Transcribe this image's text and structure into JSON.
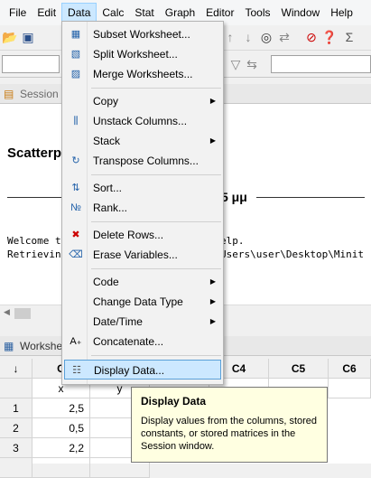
{
  "menubar": [
    "File",
    "Edit",
    "Data",
    "Calc",
    "Stat",
    "Graph",
    "Editor",
    "Tools",
    "Window",
    "Help"
  ],
  "session": {
    "tab": "Session",
    "title": "Scatterp",
    "unit": "5 μμ",
    "line1_a": "Welcome t",
    "line1_b": "elp.",
    "line2_a": "Retrievin",
    "line2_b": "Users\\user\\Desktop\\Minit"
  },
  "worksheet": {
    "tab": "Workshe",
    "columns": [
      "↓",
      "C",
      "",
      "C4",
      "C5",
      "C6"
    ],
    "names": [
      "",
      "x",
      "y",
      "",
      "",
      ""
    ],
    "rows": [
      {
        "n": "1",
        "x": "2,5"
      },
      {
        "n": "2",
        "x": "0,5"
      },
      {
        "n": "3",
        "x": "2,2"
      }
    ]
  },
  "data_menu": {
    "items": [
      {
        "label": "Subset Worksheet...",
        "icon": "subset-worksheet-icon"
      },
      {
        "label": "Split Worksheet...",
        "icon": "split-worksheet-icon"
      },
      {
        "label": "Merge Worksheets...",
        "icon": "merge-worksheets-icon"
      },
      {
        "label": "Copy",
        "submenu": true
      },
      {
        "label": "Unstack Columns...",
        "icon": "unstack-columns-icon"
      },
      {
        "label": "Stack",
        "submenu": true
      },
      {
        "label": "Transpose Columns...",
        "icon": "transpose-columns-icon"
      },
      {
        "label": "Sort...",
        "icon": "sort-icon"
      },
      {
        "label": "Rank...",
        "icon": "rank-icon"
      },
      {
        "label": "Delete Rows...",
        "icon": "delete-rows-icon"
      },
      {
        "label": "Erase Variables...",
        "icon": "erase-variables-icon"
      },
      {
        "label": "Code",
        "submenu": true
      },
      {
        "label": "Change Data Type",
        "submenu": true
      },
      {
        "label": "Date/Time",
        "submenu": true
      },
      {
        "label": "Concatenate...",
        "icon": "concatenate-icon"
      },
      {
        "label": "Display Data...",
        "icon": "display-data-icon"
      }
    ]
  },
  "tooltip": {
    "title": "Display Data",
    "body": "Display values from the columns, stored constants, or stored matrices in the Session window."
  }
}
